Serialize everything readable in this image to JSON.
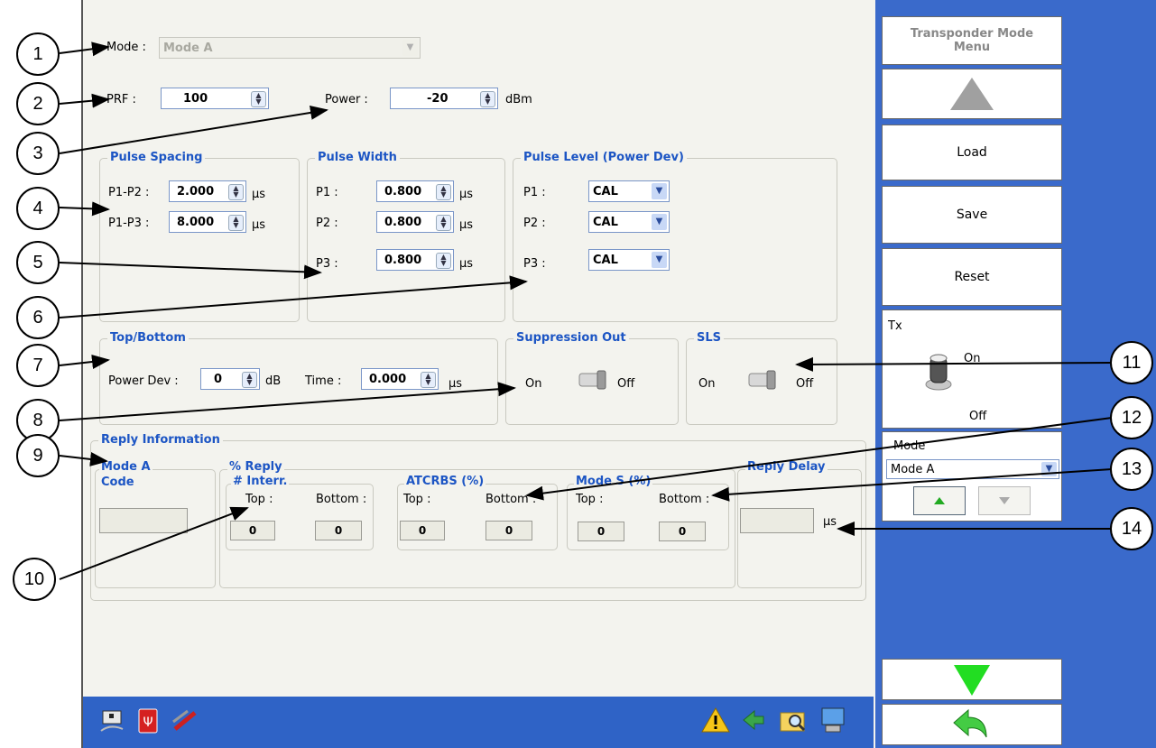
{
  "mode_row": {
    "label": "Mode :",
    "value": "Mode A"
  },
  "prf": {
    "label": "PRF :",
    "value": "100"
  },
  "power": {
    "label": "Power :",
    "value": "-20",
    "unit": "dBm"
  },
  "pulse_spacing": {
    "title": "Pulse Spacing",
    "rows": [
      {
        "label": "P1-P2 :",
        "value": "2.000",
        "unit": "µs"
      },
      {
        "label": "P1-P3 :",
        "value": "8.000",
        "unit": "µs"
      }
    ]
  },
  "pulse_width": {
    "title": "Pulse Width",
    "rows": [
      {
        "label": "P1 :",
        "value": "0.800",
        "unit": "µs"
      },
      {
        "label": "P2 :",
        "value": "0.800",
        "unit": "µs"
      },
      {
        "label": "P3 :",
        "value": "0.800",
        "unit": "µs"
      }
    ]
  },
  "pulse_level": {
    "title": "Pulse Level (Power Dev)",
    "rows": [
      {
        "label": "P1 :",
        "value": "CAL"
      },
      {
        "label": "P2 :",
        "value": "CAL"
      },
      {
        "label": "P3 :",
        "value": "CAL"
      }
    ]
  },
  "top_bottom": {
    "title": "Top/Bottom",
    "power_dev_label": "Power Dev :",
    "power_dev_value": "0",
    "power_dev_unit": "dB",
    "time_label": "Time :",
    "time_value": "0.000",
    "time_unit": "µs"
  },
  "suppression_out": {
    "title": "Suppression Out",
    "on": "On",
    "off": "Off"
  },
  "sls": {
    "title": "SLS",
    "on": "On",
    "off": "Off"
  },
  "reply_info": {
    "title": "Reply Information",
    "mode_a_code_line1": "Mode A",
    "mode_a_code_line2": "Code",
    "pct_reply": "% Reply",
    "interr": {
      "title": "# Interr.",
      "top_label": "Top :",
      "bottom_label": "Bottom :",
      "top": "0",
      "bottom": "0"
    },
    "atcrbs": {
      "title": "ATCRBS (%)",
      "top_label": "Top :",
      "bottom_label": "Bottom :",
      "top": "0",
      "bottom": "0"
    },
    "modes": {
      "title": "Mode S (%)",
      "top_label": "Top :",
      "bottom_label": "Bottom :",
      "top": "0",
      "bottom": "0"
    },
    "reply_delay": {
      "title": "Reply Delay",
      "unit": "µs"
    }
  },
  "right_panel": {
    "menu_title_line1": "Transponder Mode",
    "menu_title_line2": "Menu",
    "load": "Load",
    "save": "Save",
    "reset": "Reset",
    "tx_label": "Tx",
    "tx_on": "On",
    "tx_off": "Off",
    "mode_label": "Mode",
    "mode_value": "Mode A"
  },
  "callouts": [
    "1",
    "2",
    "3",
    "4",
    "5",
    "6",
    "7",
    "8",
    "9",
    "10",
    "11",
    "12",
    "13",
    "14"
  ],
  "colors": {
    "accent": "#1c55c4",
    "panel_blue": "#3a6acb",
    "up_arrow": "#a0a0a0",
    "down_arrow": "#22dd22"
  }
}
